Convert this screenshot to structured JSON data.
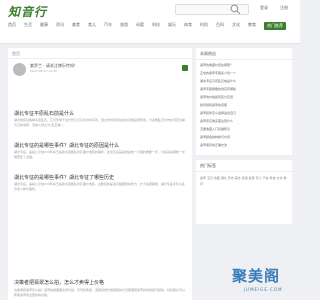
{
  "header": {
    "logo": "知音行",
    "login": "登录",
    "register": "注册",
    "nav": [
      "首页",
      "生活",
      "健康",
      "资讯",
      "美食",
      "育儿",
      "汽车",
      "旅游",
      "母婴",
      "科技",
      "娱乐",
      "体育",
      "时尚",
      "百科",
      "文化",
      "教育",
      "热门推荐"
    ]
  },
  "main": {
    "breadcrumb": "首页",
    "author": {
      "name": "紫罗兰 · 请关注博乐传知！",
      "meta": "2022-08-13 12:30"
    },
    "questions": [
      {
        "title": "湖北专征平原乱石前是什么",
        "body": "湖北地区有各种平原乱石，它们形成于古代长江与汉水冲积平原，经过长时间风化和水流搬运而形成，大多数乱石分布在河流沿岸与丘陵地带，当地人称之为“乱石滩”。"
      },
      {
        "title": "湖北专征的是哪些事件？湖北专征的原因是什么",
        "body": "湖北专征，是指公元前220年秦王嬴政派遣部队攻打湖北地区的事件，这次远征是秦始皇统一六国的重要一步，为后来秦朝统一中国奠定了基础。"
      },
      {
        "title": "湖北专征的是哪些事件？湖北专征了哪些历史",
        "body": "湖北专征，是指公元前220年秦王嬴政派遣部队攻打湖北地区，主要目的是消灭楚国残余势力，扩大秦国疆域，湖北专征涉及众多历史人物与事件。"
      }
    ],
    "article": {
      "title": "决策者把翡翠怎么拍，怎么才卖得上价格",
      "body": "决策者把翡翠怎么拍？翡翠拍摄需要注意光线、背景和角度，选择自然光或柔和的灯光能展现翡翠的通透度与颜色，好的照片可以帮助翡翠卖出更好的价格。"
    }
  },
  "sidebar": {
    "recommend_title": "本周热议",
    "recommend": [
      "翡翠的收藏价值在哪里？",
      "正常的翡翠手镯多少钱一个",
      "湖北专征平原乱石前是什么",
      "翡翠手镯佩戴的讲究有哪些",
      "翡翠的价格如何区分高低",
      "如何辨别翡翠的真假",
      "翡翠挂件怎么选择适合自己",
      "翡翠原石购买需注意什么",
      "玉器收藏入门基础知识",
      "翡翠颜色的种类与价值",
      "翡翠保养的正确方法"
    ],
    "tags_title": "热门标签",
    "tags": "翡翠 玉石 收藏 湖北 历史 美食 旅游 健康 育儿 汽车 科技 文化 教育"
  },
  "watermark": {
    "main": "聚美阁",
    "sub": "JUMEIGE.COM"
  }
}
